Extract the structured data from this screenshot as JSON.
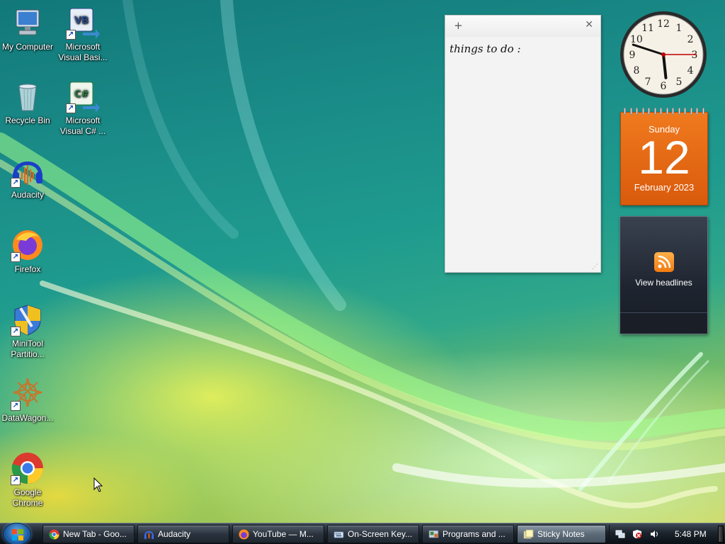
{
  "desktop": {
    "icons": [
      {
        "label": "My Computer",
        "icon": "computer-icon"
      },
      {
        "label": "Microsoft Visual Basi...",
        "icon": "visual-basic-icon",
        "badge": "VB"
      },
      {
        "label": "Recycle Bin",
        "icon": "recycle-bin-icon"
      },
      {
        "label": "Microsoft Visual C# ...",
        "icon": "visual-csharp-icon",
        "badge": "C#"
      },
      {
        "label": "Audacity",
        "icon": "audacity-icon"
      },
      {
        "label": "Firefox",
        "icon": "firefox-icon"
      },
      {
        "label": "MiniTool Partitio...",
        "icon": "minitool-icon"
      },
      {
        "label": "DataWagon...",
        "icon": "datawagon-icon"
      },
      {
        "label": "Google Chrome",
        "icon": "chrome-icon"
      }
    ]
  },
  "sticky_note": {
    "add_label": "+",
    "close_label": "✕",
    "text": "things to do :"
  },
  "clock": {
    "hour": 5,
    "minute": 48,
    "second": 15
  },
  "calendar": {
    "day_name": "Sunday",
    "day_number": "12",
    "month_year": "February 2023"
  },
  "feed_gadget": {
    "label": "View headlines"
  },
  "taskbar": {
    "tasks": [
      {
        "label": "New Tab - Goo...",
        "icon": "chrome-icon"
      },
      {
        "label": "Audacity",
        "icon": "audacity-icon"
      },
      {
        "label": "YouTube — M...",
        "icon": "firefox-icon"
      },
      {
        "label": "On-Screen Key...",
        "icon": "keyboard-icon"
      },
      {
        "label": "Programs and ...",
        "icon": "control-panel-icon"
      },
      {
        "label": "Sticky Notes",
        "icon": "sticky-notes-icon",
        "active": true
      }
    ],
    "tray_time": "5:48 PM"
  },
  "colors": {
    "calendar_orange": "#e8681a",
    "clock_hand": "#c00000"
  }
}
